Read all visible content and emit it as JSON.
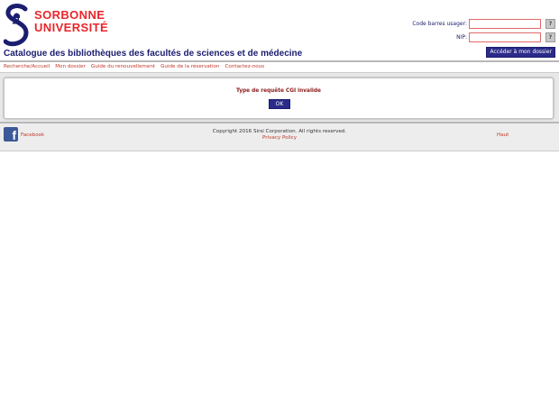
{
  "header": {
    "logo_line1": "SORBONNE",
    "logo_line2": "UNIVERSITÉ",
    "catalog_title": "Catalogue des bibliothèques des facultés de sciences et de médecine"
  },
  "login": {
    "barcode_label": "Code barres usager:",
    "barcode_value": "",
    "pin_label": "NIP:",
    "pin_value": "",
    "help_label": "?",
    "access_button": "Accéder à mon dossier"
  },
  "nav": {
    "items": [
      "Recherche/Accueil",
      "Mon dossier",
      "Guide du renouvellement",
      "Guide de la réservation",
      "Contactez-nous"
    ]
  },
  "content": {
    "error_message": "Type de requête CGI invalide",
    "ok_button": "OK"
  },
  "footer": {
    "facebook_label": "Facebook",
    "copyright": "Copyright 2016 Sirsi Corporation. All rights reserved.",
    "privacy": "Privacy Policy",
    "top_link": "Haut"
  },
  "colors": {
    "brand_red": "#e8262b",
    "brand_blue": "#1b1d6f",
    "link_red": "#c0392b",
    "button_blue": "#2b2b8a",
    "facebook_blue": "#3b5998"
  },
  "icons": {
    "logo": "sorbonne-s-logo-icon",
    "help": "help-icon",
    "facebook": "facebook-icon"
  }
}
